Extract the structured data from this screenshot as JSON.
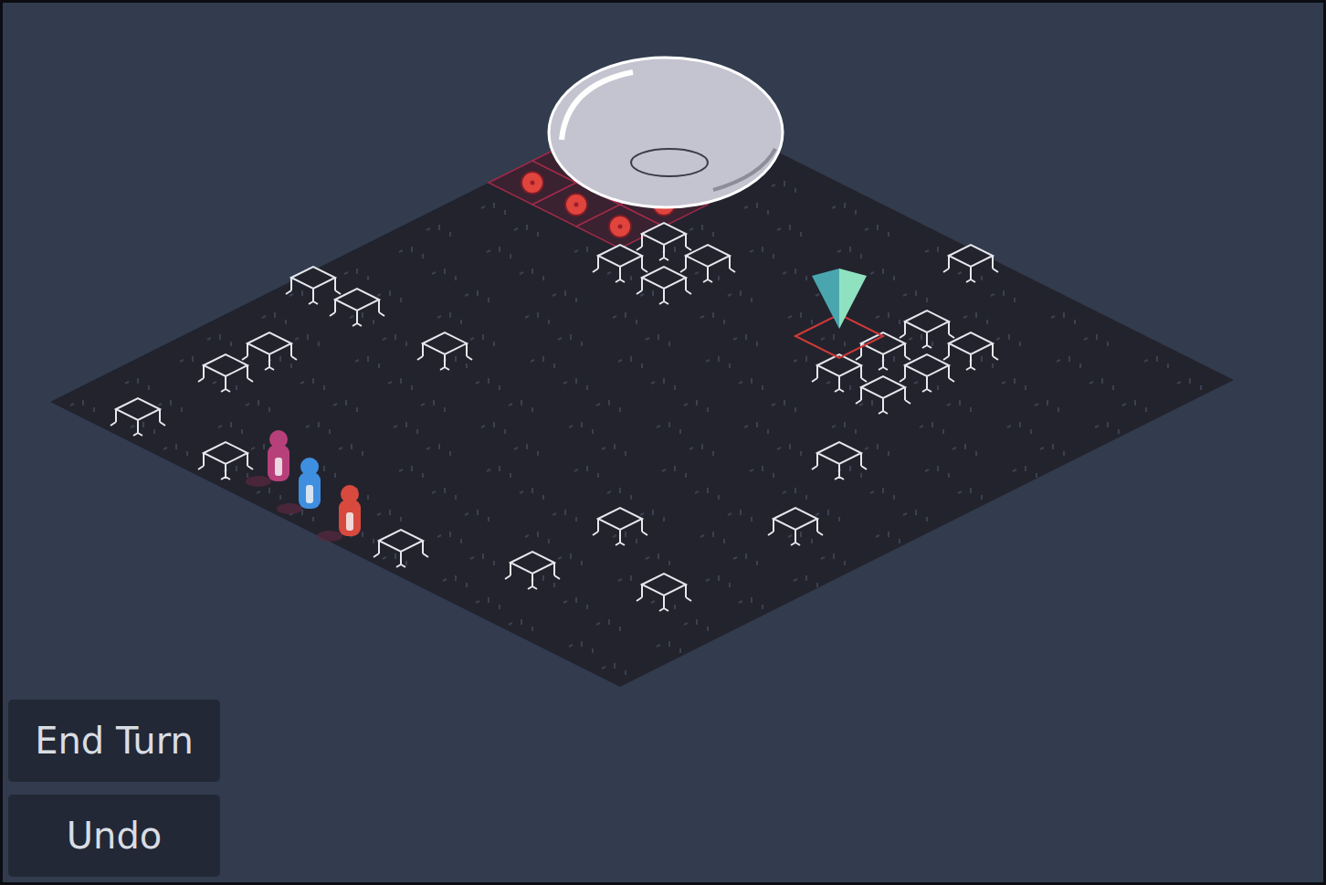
{
  "buttons": [
    {
      "label": "End Turn"
    },
    {
      "label": "Undo"
    }
  ],
  "units": [
    {
      "color": "#b8407a"
    },
    {
      "color": "#3f8fe0"
    },
    {
      "color": "#d8493e"
    }
  ]
}
